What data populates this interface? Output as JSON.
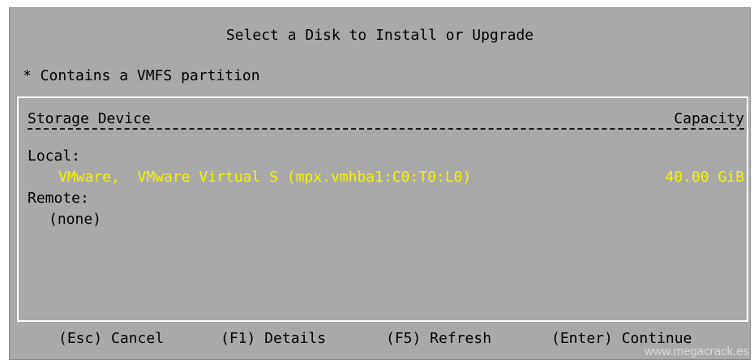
{
  "dialog": {
    "title": "Select a Disk to Install or Upgrade",
    "note": "* Contains a VMFS partition"
  },
  "table": {
    "headers": {
      "device": "Storage Device",
      "capacity": "Capacity"
    },
    "local_label": "Local:",
    "local_devices": [
      {
        "name": "VMware,  VMware Virtual S (mpx.vmhba1:C0:T0:L0)",
        "capacity": "40.00 GiB",
        "selected": true
      }
    ],
    "remote_label": "Remote:",
    "remote_devices_text": "(none)"
  },
  "footer": {
    "cancel": "(Esc) Cancel",
    "details": "(F1) Details",
    "refresh": "(F5) Refresh",
    "continue": "(Enter) Continue"
  },
  "watermark": "www.megacrack.es",
  "colors": {
    "background": "#a9a9a9",
    "selected_text": "#f2f200",
    "border": "#ffffff"
  }
}
